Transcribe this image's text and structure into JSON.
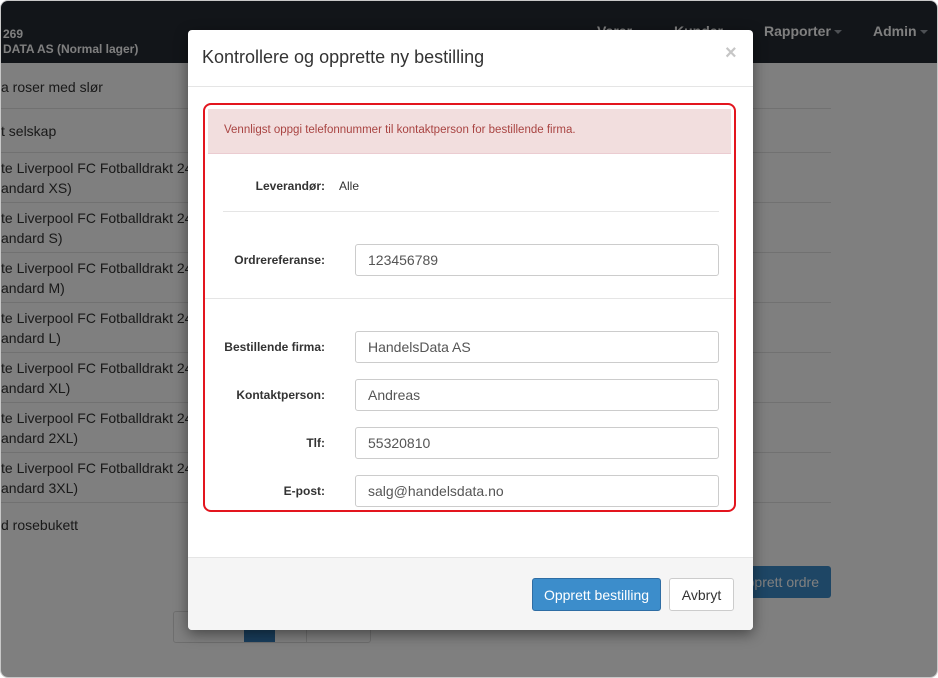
{
  "navbar": {
    "brand_line1": "269",
    "brand_line2": "DATA AS (Normal lager)",
    "items": [
      {
        "label": "Varer"
      },
      {
        "label": "Kunder"
      },
      {
        "label": "Rapporter"
      },
      {
        "label": "Admin"
      }
    ]
  },
  "background": {
    "rows": [
      {
        "line1": "a roser med slør",
        "line2": ""
      },
      {
        "line1": "t selskap",
        "line2": ""
      },
      {
        "line1": "te Liverpool FC Fotballdrakt 24",
        "line2": "andard XS)"
      },
      {
        "line1": "te Liverpool FC Fotballdrakt 24",
        "line2": "andard S)"
      },
      {
        "line1": "te Liverpool FC Fotballdrakt 24",
        "line2": "andard M)"
      },
      {
        "line1": "te Liverpool FC Fotballdrakt 24",
        "line2": "andard L)"
      },
      {
        "line1": "te Liverpool FC Fotballdrakt 24",
        "line2": "andard XL)"
      },
      {
        "line1": "te Liverpool FC Fotballdrakt 24",
        "line2": "andard 2XL)"
      },
      {
        "line1": "te Liverpool FC Fotballdrakt 24",
        "line2": "andard 3XL)"
      },
      {
        "line1": "d rosebukett",
        "line2": ""
      }
    ],
    "create_order_label": "Opprett ordre"
  },
  "modal": {
    "title": "Kontrollere og opprette ny bestilling",
    "close_label": "×",
    "alert": "Vennligst oppgi telefonnummer til kontaktperson for bestillende firma.",
    "supplier_label": "Leverandør:",
    "supplier_value": "Alle",
    "order_ref_label": "Ordrereferanse:",
    "order_ref_value": "123456789",
    "company_label": "Bestillende firma:",
    "company_value": "HandelsData AS",
    "contact_label": "Kontaktperson:",
    "contact_value": "Andreas",
    "phone_label": "Tlf:",
    "phone_value": "55320810",
    "email_label": "E-post:",
    "email_value": "salg@handelsdata.no",
    "submit_label": "Opprett bestilling",
    "cancel_label": "Avbryt"
  },
  "colors": {
    "navbar": "#252a33",
    "primary": "#3c8dcb",
    "alert_bg": "#f2dede",
    "alert_text": "#a94442",
    "highlight": "#e3151e"
  }
}
